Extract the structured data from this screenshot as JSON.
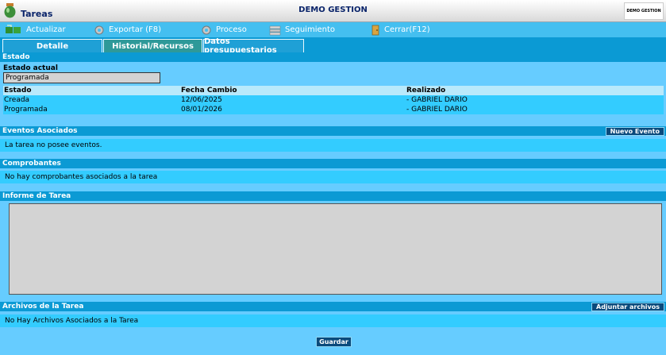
{
  "titlebar": {
    "title": "Tareas",
    "company": "DEMO GESTION",
    "logo_text": "DEMO GESTION"
  },
  "toolbar": {
    "actualizar": "Actualizar",
    "exportar": "Exportar (F8)",
    "proceso": "Proceso",
    "seguimiento": "Seguimiento",
    "cerrar": "Cerrar(F12)"
  },
  "tabs": {
    "detalle": "Detalle",
    "historial": "Historial/Recursos",
    "datos": "Datos presupuestarios",
    "active": "Historial/Recursos"
  },
  "estado": {
    "section_title": "Estado",
    "current_label": "Estado actual",
    "current_value": "Programada",
    "columns": [
      "Estado",
      "Fecha Cambio",
      "Realizado"
    ],
    "rows": [
      [
        "Creada",
        "12/06/2025",
        "- GABRIEL DARIO"
      ],
      [
        "Programada",
        "08/01/2026",
        "- GABRIEL DARIO"
      ]
    ]
  },
  "eventos": {
    "section_title": "Eventos Asociados",
    "button": "Nuevo Evento",
    "message": "La tarea no posee eventos."
  },
  "comprobantes": {
    "section_title": "Comprobantes",
    "message": "No hay comprobantes asociados a la tarea"
  },
  "informe": {
    "section_title": "Informe de Tarea",
    "value": ""
  },
  "archivos": {
    "section_title": "Archivos de la Tarea",
    "button": "Adjuntar archivos",
    "message": "No Hay Archivos Asociados a la Tarea"
  },
  "footer": {
    "guardar": "Guardar"
  },
  "colors": {
    "panel": "#66ccff",
    "header": "#0b9ad4",
    "row": "#33ccff",
    "button": "#0a4a7c"
  }
}
